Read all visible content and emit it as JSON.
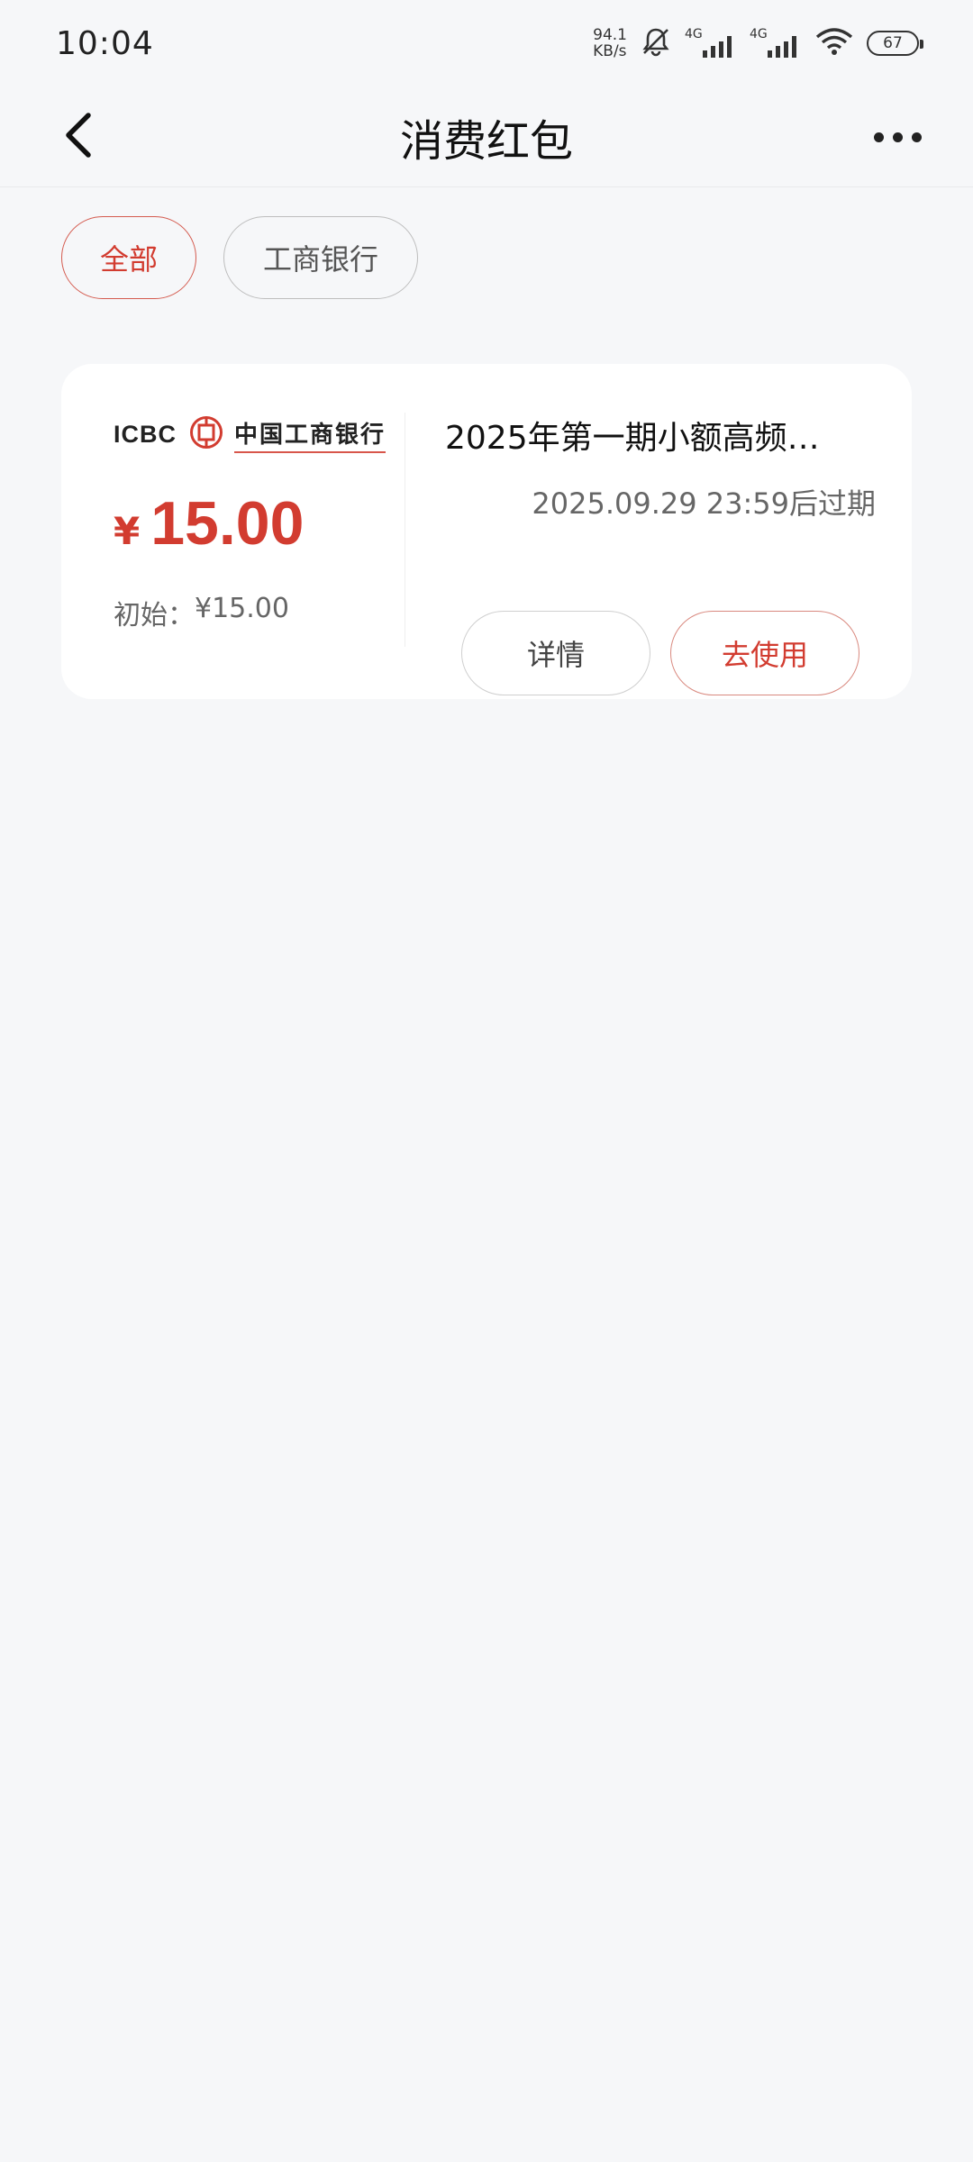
{
  "status_bar": {
    "time": "10:04",
    "net_speed_value": "94.1",
    "net_speed_unit": "KB/s",
    "signal1_label": "4G",
    "signal2_label": "4G",
    "battery": "67"
  },
  "nav": {
    "title": "消费红包"
  },
  "filters": [
    {
      "label": "全部",
      "active": true
    },
    {
      "label": "工商银行",
      "active": false
    }
  ],
  "coupon": {
    "bank_logo_latin": "ICBC",
    "bank_logo_cn": "中国工商银行",
    "currency": "¥",
    "amount": "15.00",
    "initial_label": "初始：",
    "initial_value": "¥15.00",
    "title": "2025年第一期小额高频…",
    "expiry": "2025.09.29 23:59后过期",
    "details_label": "详情",
    "use_label": "去使用"
  },
  "colors": {
    "accent": "#d23c30",
    "background": "#f6f7f9",
    "card": "#ffffff"
  }
}
